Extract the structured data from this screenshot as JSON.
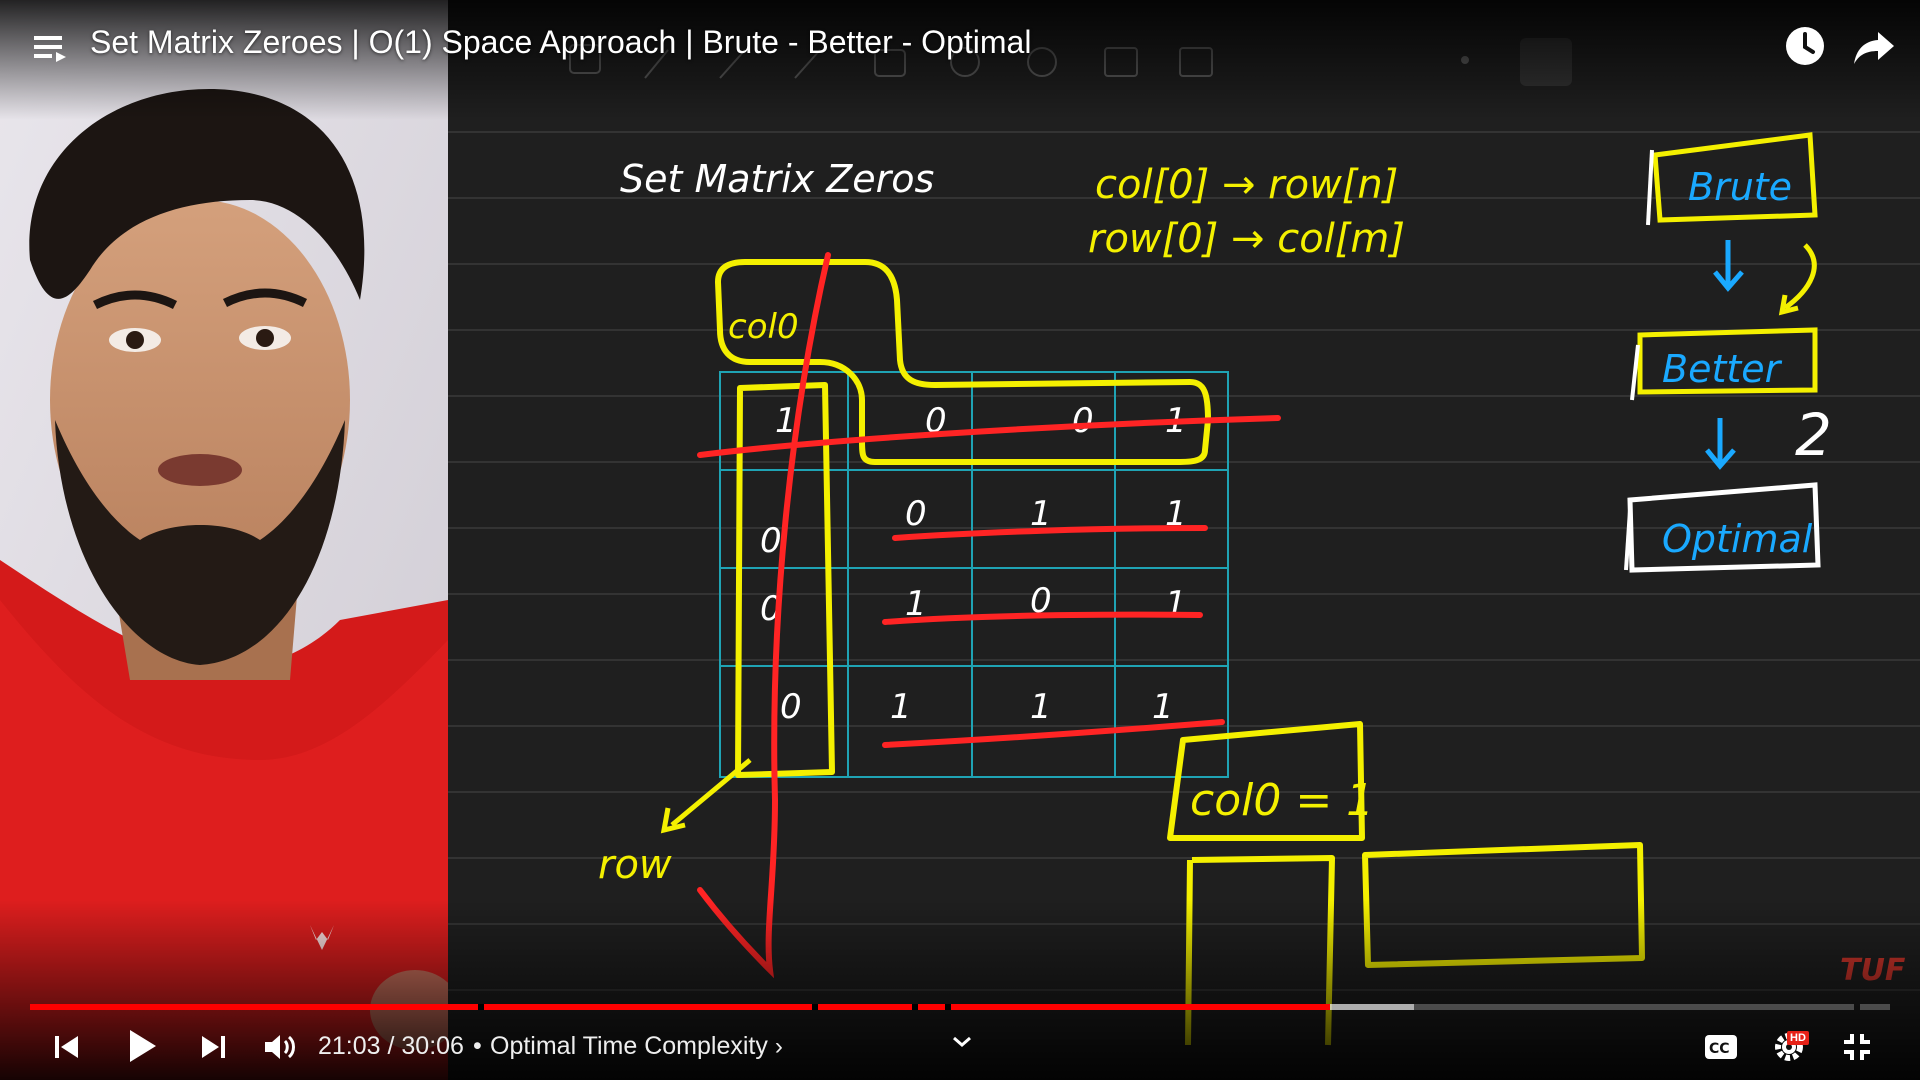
{
  "title_bar": {
    "title": "Set Matrix Zeroes | O(1) Space Approach | Brute - Better - Optimal"
  },
  "board": {
    "heading": "Set Matrix Zeros",
    "mapping_line1": "col[0] → row[n]",
    "mapping_line2": "row[0] → col[m]",
    "col0_tag": "col0",
    "col0_eq": "col0 = 1",
    "row_label": "row",
    "approaches": [
      "Brute",
      "Better",
      "Optimal"
    ],
    "step_number": "2",
    "matrix": [
      [
        "1",
        "0",
        "0",
        "1"
      ],
      [
        "0",
        "0",
        "1",
        "1"
      ],
      [
        "0",
        "1",
        "0",
        "1"
      ],
      [
        "0",
        "1",
        "1",
        "1"
      ]
    ],
    "watermark": "TUF"
  },
  "player": {
    "current_time": "21:03",
    "duration": "30:06",
    "time_text": "21:03 / 30:06",
    "chapter": "Optimal Time Complexity",
    "played_fraction": 0.699,
    "buffered_fraction": 0.744,
    "hd_badge": "HD",
    "colors": {
      "progress": "#ff0000",
      "pen_yellow": "#f4f000",
      "pen_red": "#ff2020",
      "pen_blue": "#1aa9ff"
    },
    "icons": [
      "menu-icon",
      "watch-later-icon",
      "share-icon",
      "previous-icon",
      "play-icon",
      "next-icon",
      "volume-icon",
      "chevron-right-icon",
      "chevron-down-icon",
      "captions-icon",
      "settings-icon",
      "exit-fullscreen-icon"
    ]
  }
}
